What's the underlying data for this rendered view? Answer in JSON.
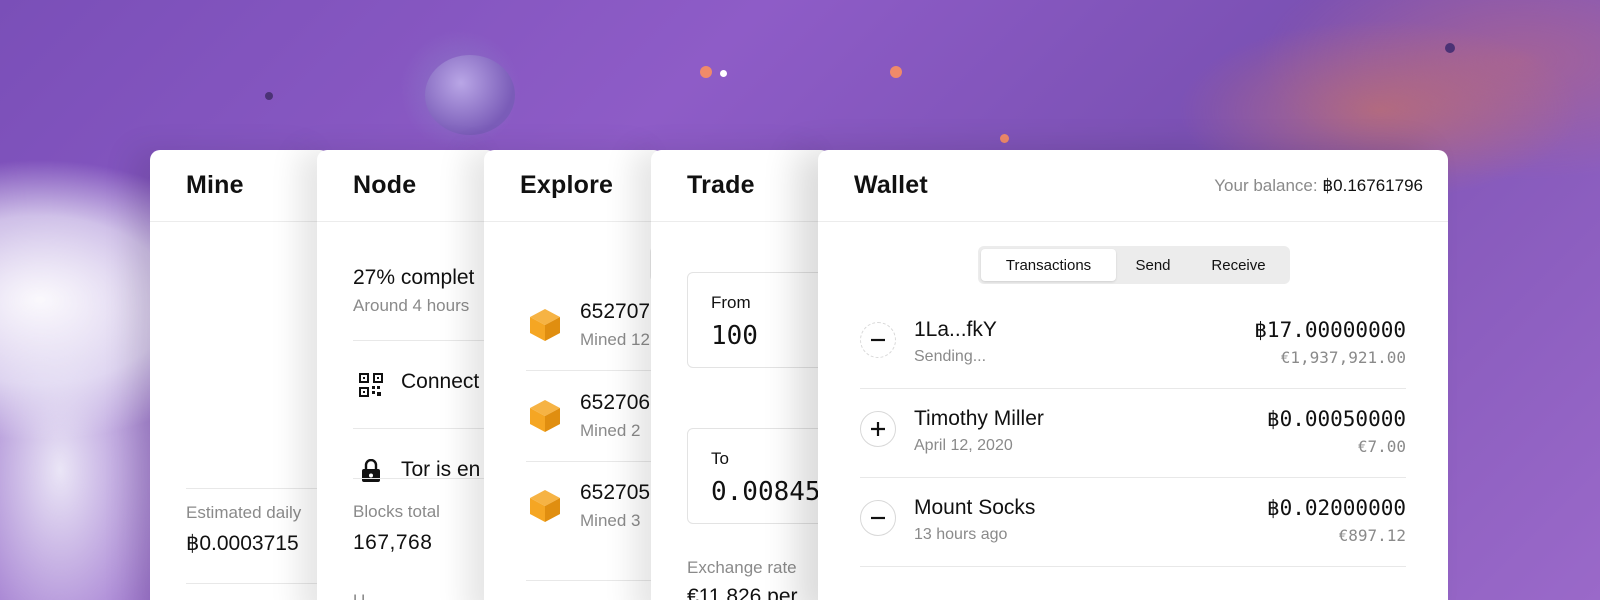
{
  "panels": {
    "mine": {
      "title": "Mine",
      "estimated_label": "Estimated daily",
      "estimated_value": "฿0.0003715"
    },
    "node": {
      "title": "Node",
      "progress_text": "27% complet",
      "eta": "Around 4 hours",
      "connect_label": "Connect",
      "tor_label": "Tor is en",
      "blocks_label": "Blocks total",
      "blocks_value": "167,768",
      "cut_label": "U"
    },
    "explore": {
      "title": "Explore",
      "blocks": [
        {
          "number": "652707",
          "mined": "Mined 12"
        },
        {
          "number": "652706",
          "mined": "Mined 2"
        },
        {
          "number": "652705",
          "mined": "Mined 3"
        }
      ]
    },
    "trade": {
      "title": "Trade",
      "from_label": "From",
      "from_value": "100",
      "to_label": "To",
      "to_value": "0.00845",
      "rate_label": "Exchange rate",
      "rate_value": "€11,826 per"
    },
    "wallet": {
      "title": "Wallet",
      "balance_label": "Your balance:",
      "balance_value": "฿0.16761796",
      "tabs": [
        "Transactions",
        "Send",
        "Receive"
      ],
      "active_tab": "Transactions",
      "transactions": [
        {
          "name": "1La...fkY",
          "sub": "Sending...",
          "amount": "฿17.00000000",
          "fiat": "€1,937,921.00",
          "direction": "minus",
          "pending": true
        },
        {
          "name": "Timothy Miller",
          "sub": "April 12, 2020",
          "amount": "฿0.00050000",
          "fiat": "€7.00",
          "direction": "plus",
          "pending": false
        },
        {
          "name": "Mount Socks",
          "sub": "13 hours ago",
          "amount": "฿0.02000000",
          "fiat": "€897.12",
          "direction": "minus",
          "pending": false
        }
      ]
    }
  },
  "colors": {
    "accent_orange": "#f5a623",
    "background_purple": "#7e52bb",
    "muted_text": "#8a8a8a"
  }
}
